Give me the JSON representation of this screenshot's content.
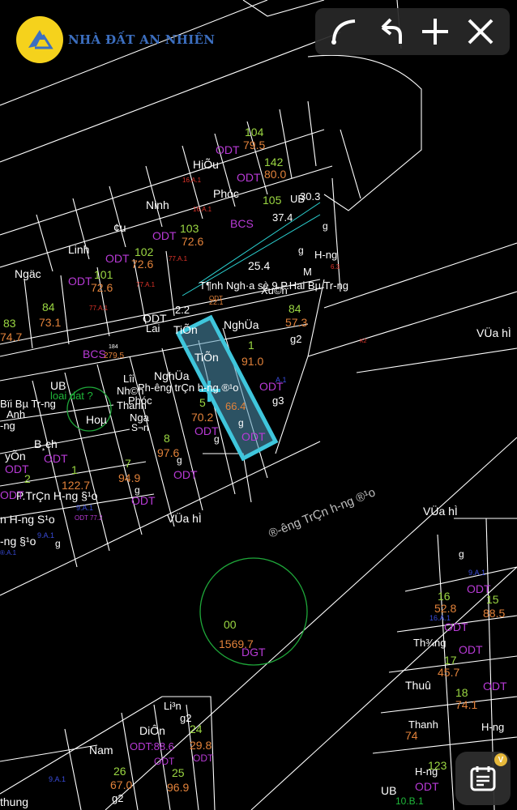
{
  "brand": {
    "name": "NHÀ ĐẤT AN NHIÊN"
  },
  "toolbar": {
    "icons": [
      "curve-draw-icon",
      "undo-icon",
      "plus-icon",
      "close-icon"
    ]
  },
  "fab": {
    "icon": "calendar-icon",
    "badge": "V"
  },
  "colors": {
    "parcel_line": "#ffffff",
    "road_line": "#2bd3d3",
    "selected": "#3fc6dc",
    "odt": "#b83ad6",
    "id": "#9bd742",
    "area": "#e2823a",
    "circle": "#1fa83a"
  },
  "labels": {
    "l1": "104",
    "l2": "79.5",
    "l3": "ODT",
    "l4": "HiÕu",
    "l5": "142",
    "l6": "80.0",
    "l7": "ODT",
    "l8": "16.A.1",
    "l9": "Ninh",
    "l10": "Phóc",
    "l11": "105",
    "l12": "UB",
    "l13": "30.3",
    "l14": "37.4",
    "l15": "BCS",
    "l16": "16.A.1",
    "l17": "103",
    "l18": "72.6",
    "l19": "ODT",
    "l20": "¢u",
    "l21": "g",
    "l22": "Linh",
    "l23": "102",
    "l24": "72.6",
    "l25": "ODT",
    "l26": "77.A.1",
    "l27": "g",
    "l28": "H-ng",
    "l29": "6.3",
    "l30": "25.4",
    "l31": "Ngäc",
    "l32": "101",
    "l33": "72.6",
    "l34": "ODT",
    "l35": "77.A.1",
    "l36": "M",
    "l37": "T¶nh Ngh·a sè 9 P.Hai Bµ Tr-ng",
    "l38": "ODT",
    "l39": "77.A.1",
    "l40": "Xu©n",
    "l41": "22.1",
    "l42": "84",
    "l43": "73.1",
    "l44": "83",
    "l45": "74.7",
    "l46": "2.2",
    "l47": "ODT",
    "l48": "Lai",
    "l49": "TiÕn",
    "l50": "NghÜa",
    "l51": "84",
    "l52": "57.3",
    "l53": "g2",
    "l54": "VÜa hÌ",
    "l55": "K2",
    "l56": "BCS",
    "l57": "184",
    "l58": "279.5",
    "l59": "TiÕn",
    "l60": "1",
    "l61": "91.0",
    "l62": "A.1",
    "l63": "UB",
    "l64": "Lîi",
    "l65": "NghÜa",
    "l66": "Nh©n",
    "l67": "Phóc",
    "l68": "Thanh",
    "l69": "Nga",
    "l70": "S¬n",
    "l71": "loai dat ?",
    "l72": "Bïi Bµ Tr-ng",
    "l73": "Anh",
    "l74": "-ng",
    "l75": "Hoµ",
    "l76": "5",
    "l77": "70.2",
    "l78": "ODT",
    "l79": "g",
    "l80": "66.4",
    "l81": "ODT",
    "l82": "g",
    "l83": "ODT",
    "l84": "g3",
    "l85": "Ph-êng trÇn h-ng ®¹o",
    "l86": "B¸ch",
    "l87": "ODT",
    "l88": "8",
    "l89": "97.6",
    "l90": "g",
    "l91": "yÕn",
    "l92": "ODT",
    "l93": "1",
    "l94": "122.7",
    "l95": "7",
    "l96": "94.9",
    "l97": "g",
    "l98": "ODT",
    "l99": "2",
    "l100": "P.TrÇn H-ng §¹o",
    "l101": "ODT",
    "l102": "9.A.1",
    "l103": "ODT 77.2",
    "l104": "ODT",
    "l105": "n H-ng S¹o",
    "l106": "VÜa hÌ",
    "l107": "9.A.1",
    "l108": "g",
    "l109": "-ng §¹o",
    "l110": "®.A.1",
    "l111": "®-êng TrÇn h-ng ®¹o",
    "l112": "VÜa hÌ",
    "l113": "g",
    "l114": "9.A.1",
    "l115": "ODT",
    "l116": "16",
    "l117": "52.8",
    "l118": "15",
    "l119": "88.5",
    "l120": "16.A.1",
    "l121": "ODT",
    "l122": "00",
    "l123": "1569.7",
    "l124": "DGT",
    "l125": "Th¾ng",
    "l126": "ODT",
    "l127": "17",
    "l128": "45.7",
    "l129": "Thuû",
    "l130": "18",
    "l131": "74.1",
    "l132": "ODT",
    "l133": "Li³n",
    "l134": "g2",
    "l135": "DiÔn",
    "l136": "24",
    "l137": "ODT:88.6",
    "l138": "29.8",
    "l139": "Nam",
    "l140": "26",
    "l141": "ODT",
    "l142": "ODT",
    "l143": "25",
    "l144": "96.9",
    "l145": "9.A.1",
    "l146": "67.0",
    "l147": "g2",
    "l148": "Thanh",
    "l149": "74",
    "l150": "H-ng",
    "l151": "123",
    "l152": "H-ng",
    "l153": "ODT",
    "l154": "UB",
    "l155": "10.B.1",
    "l156": "thung"
  }
}
